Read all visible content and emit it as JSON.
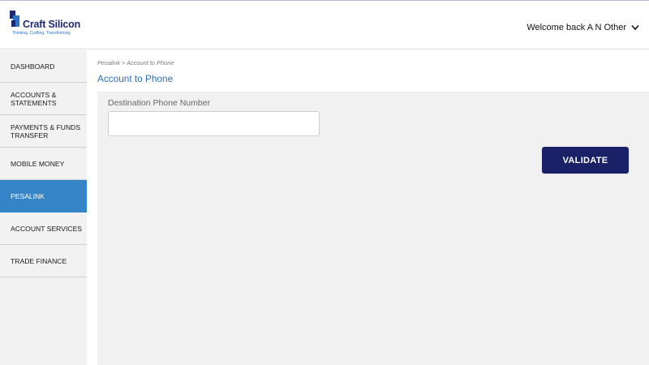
{
  "header": {
    "logo": {
      "name": "Craft Silicon",
      "tagline": "Thinking. Crafting. Transforming."
    },
    "welcome_text": "Welcome back A N Other",
    "welcome_icon": "chevron-down-icon"
  },
  "sidebar": {
    "items": [
      {
        "label": "DASHBOARD",
        "active": false
      },
      {
        "label": "ACCOUNTS & STATEMENTS",
        "active": false
      },
      {
        "label": "PAYMENTS & FUNDS TRANSFER",
        "active": false
      },
      {
        "label": "MOBILE MONEY",
        "active": false
      },
      {
        "label": "PESALINK",
        "active": true
      },
      {
        "label": "ACCOUNT SERVICES",
        "active": false
      },
      {
        "label": "TRADE FINANCE",
        "active": false
      }
    ]
  },
  "main": {
    "breadcrumb": "Pesalink > Account to Phone",
    "title": "Account to Phone",
    "form": {
      "phone_label": "Destination Phone Number",
      "phone_value": "",
      "phone_placeholder": ""
    },
    "validate_label": "VALIDATE"
  },
  "colors": {
    "brand_dark": "#1a2167",
    "accent_blue": "#3584c7",
    "title_blue": "#2e6fb4",
    "panel_bg": "#f1f1f1"
  }
}
